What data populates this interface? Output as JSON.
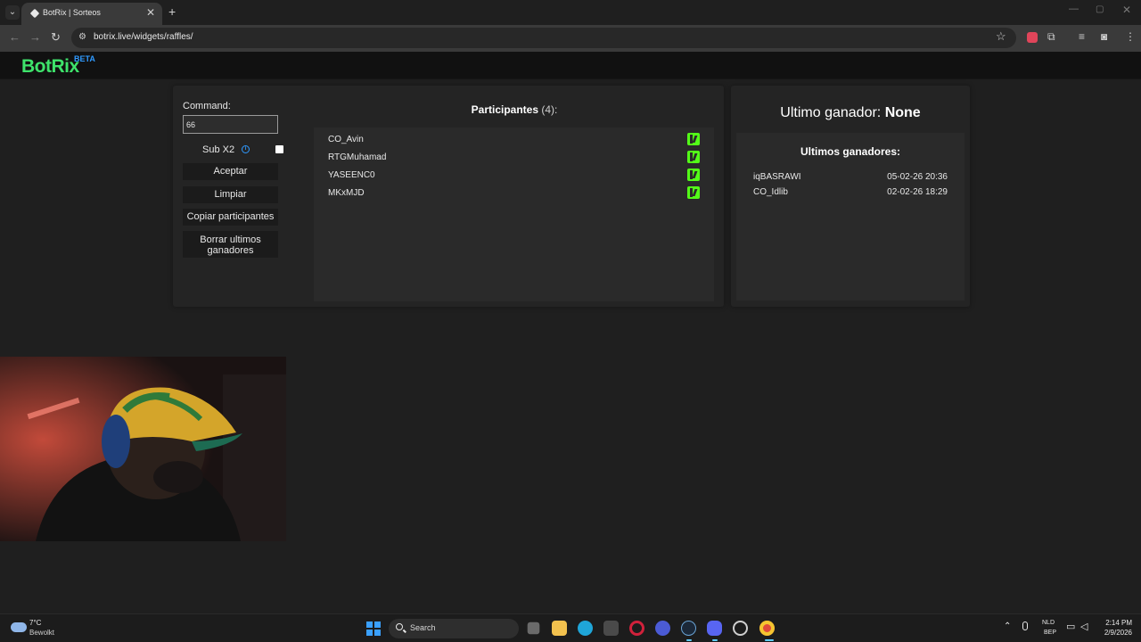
{
  "browser": {
    "tab_title": "BotRix | Sorteos",
    "tab_close": "✕",
    "new_tab": "+",
    "url": "botrix.live/widgets/raffles/",
    "back": "←",
    "forward": "→",
    "reload": "↻",
    "bookmark": "☆",
    "menu": "⋮",
    "win_min": "—",
    "win_max": "▢",
    "win_close": "✕",
    "icons": [
      "tab-search-icon",
      "site-info-icon",
      "extension-red-icon",
      "puzzle-extensions-icon",
      "media-queue-icon",
      "profile-icon",
      "menu-icon"
    ]
  },
  "site": {
    "logo": "BotRix",
    "logo_badge": "BETA",
    "brand_color": "#3ee36b"
  },
  "raffle": {
    "command_label": "Command:",
    "command_value": "66",
    "subx2_label": "Sub X2",
    "subx2_checked": false,
    "buttons": {
      "accept": "Aceptar",
      "clear": "Limpiar",
      "copy": "Copiar participantes",
      "delete_winners": "Borrar ultimos ganadores"
    },
    "participants_title": "Participantes",
    "participants_count": "(4):",
    "participants": [
      {
        "name": "CO_Avin",
        "platform": "kick"
      },
      {
        "name": "RTGMuhamad",
        "platform": "kick"
      },
      {
        "name": "YASEENC0",
        "platform": "kick"
      },
      {
        "name": "MKxMJD",
        "platform": "kick"
      }
    ],
    "kick_color": "#53fc18"
  },
  "winners": {
    "last_winner_label": "Ultimo ganador:",
    "last_winner_value": "None",
    "recent_title": "Ultimos ganadores:",
    "recent": [
      {
        "name": "iqBASRAWI",
        "date": "05-02-26 20:36"
      },
      {
        "name": "CO_Idlib",
        "date": "02-02-26 18:29"
      }
    ]
  },
  "taskbar": {
    "weather_temp": "7°C",
    "weather_desc": "Bewolkt",
    "search_label": "Search",
    "lang_line1": "NLD",
    "lang_line2": "BEP",
    "time": "2:14 PM",
    "date": "2/9/2026",
    "apps": [
      "task-view-icon",
      "file-explorer-icon",
      "edge-icon",
      "store-icon",
      "opera-icon",
      "copilot-icon",
      "steam-icon",
      "discord-icon",
      "gamebar-icon",
      "chrome-icon"
    ]
  }
}
